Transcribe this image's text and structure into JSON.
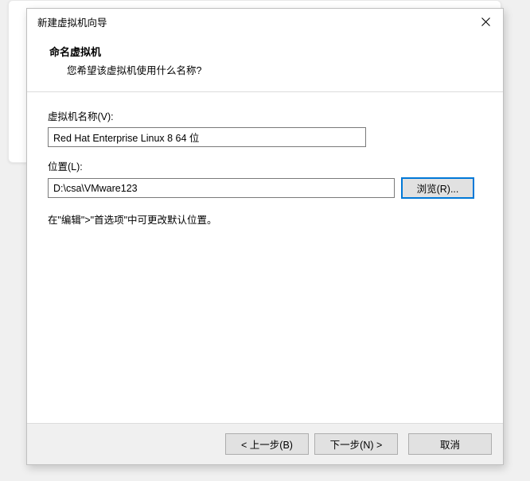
{
  "titlebar": {
    "title": "新建虚拟机向导"
  },
  "header": {
    "title": "命名虚拟机",
    "subtitle": "您希望该虚拟机使用什么名称?"
  },
  "fields": {
    "name": {
      "label": "虚拟机名称(V):",
      "value": "Red Hat Enterprise Linux 8 64 位"
    },
    "location": {
      "label": "位置(L):",
      "value": "D:\\csa\\VMware123",
      "browse_label": "浏览(R)..."
    }
  },
  "hint": "在\"编辑\">\"首选项\"中可更改默认位置。",
  "footer": {
    "back": "< 上一步(B)",
    "next": "下一步(N) >",
    "cancel": "取消"
  }
}
